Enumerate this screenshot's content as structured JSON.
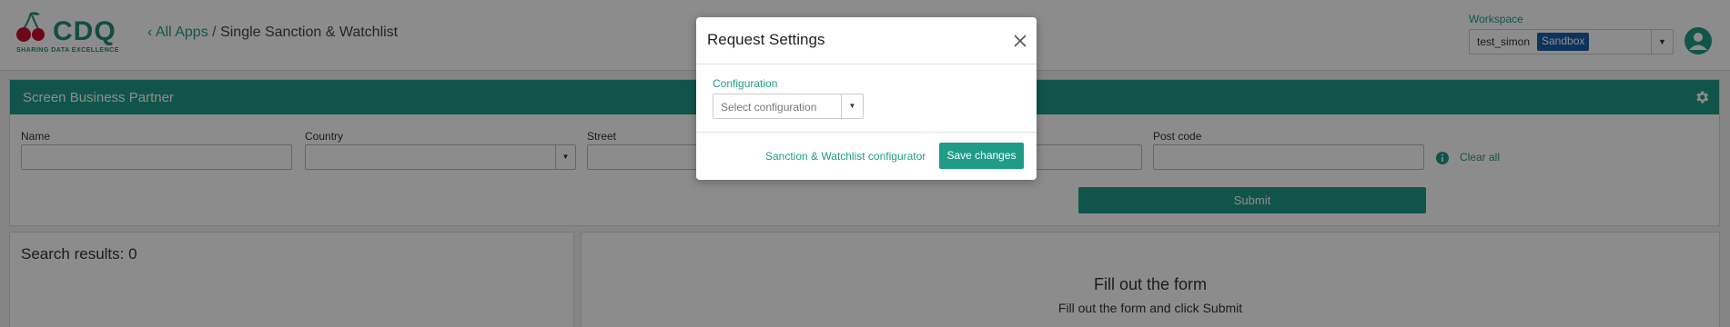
{
  "colors": {
    "accent": "#1f9c88",
    "badge": "#1a5fa8",
    "overlay": "rgba(0,0,0,0.45)"
  },
  "header": {
    "logo_text": "CDQ",
    "logo_tagline": "SHARING DATA EXCELLENCE",
    "breadcrumb": {
      "back_icon": "chevron-left-icon",
      "back_label": "All Apps",
      "separator": "/",
      "current": "Single Sanction & Watchlist"
    },
    "workspace": {
      "label": "Workspace",
      "value": "test_simon",
      "badge": "Sandbox",
      "dropdown_icon": "caret-down-icon"
    },
    "avatar_icon": "user-avatar-icon"
  },
  "screen_panel": {
    "title": "Screen Business Partner",
    "settings_icon": "gear-icon",
    "fields": {
      "name": "Name",
      "country": "Country",
      "street": "Street",
      "postcode": "Post code"
    },
    "info_icon": "info-icon",
    "clear_all": "Clear all",
    "submit": "Submit"
  },
  "results": {
    "title": "Search results: 0"
  },
  "form_panel": {
    "title": "Fill out the form",
    "subtitle": "Fill out the form and click Submit"
  },
  "modal": {
    "title": "Request Settings",
    "close_icon": "close-icon",
    "config_label": "Configuration",
    "config_placeholder": "Select configuration",
    "configurator_link": "Sanction & Watchlist configurator",
    "save": "Save changes"
  }
}
